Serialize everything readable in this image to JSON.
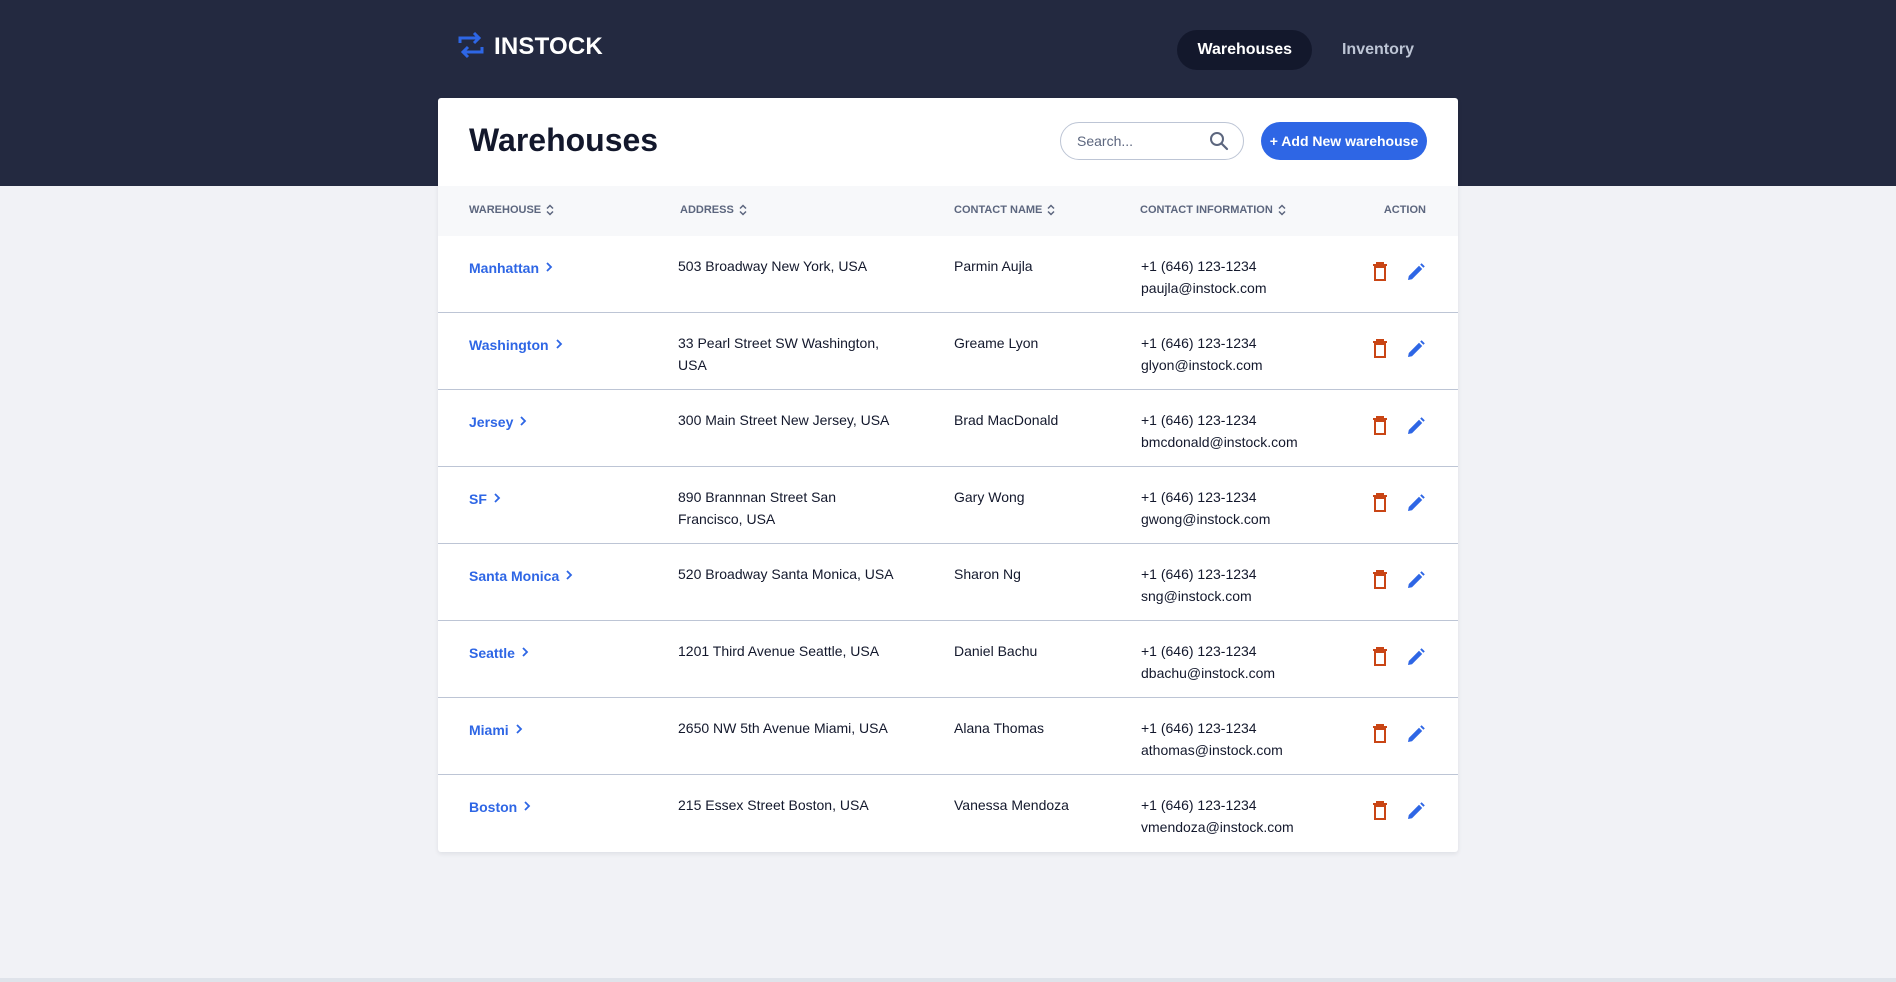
{
  "header": {
    "logo_text": "INSTOCK",
    "nav": [
      {
        "label": "Warehouses",
        "active": true
      },
      {
        "label": "Inventory",
        "active": false
      }
    ]
  },
  "page": {
    "title": "Warehouses",
    "search_placeholder": "Search...",
    "add_button_label": "+ Add New warehouse"
  },
  "table": {
    "columns": [
      "WAREHOUSE",
      "ADDRESS",
      "CONTACT NAME",
      "CONTACT INFORMATION",
      "ACTION"
    ],
    "rows": [
      {
        "warehouse": "Manhattan",
        "address": "503 Broadway New York, USA",
        "contact": "Parmin Aujla",
        "phone": "+1 (646) 123-1234",
        "email": "paujla@instock.com"
      },
      {
        "warehouse": "Washington",
        "address": "33 Pearl Street SW Washington, USA",
        "contact": "Greame Lyon",
        "phone": "+1 (646) 123-1234",
        "email": "glyon@instock.com"
      },
      {
        "warehouse": "Jersey",
        "address": "300 Main Street New Jersey, USA",
        "contact": "Brad MacDonald",
        "phone": "+1 (646) 123-1234",
        "email": "bmcdonald@instock.com"
      },
      {
        "warehouse": "SF",
        "address": "890 Brannnan Street San Francisco, USA",
        "contact": "Gary Wong",
        "phone": "+1 (646) 123-1234",
        "email": "gwong@instock.com"
      },
      {
        "warehouse": "Santa Monica",
        "address": "520 Broadway Santa Monica, USA",
        "contact": "Sharon Ng",
        "phone": "+1 (646) 123-1234",
        "email": "sng@instock.com"
      },
      {
        "warehouse": "Seattle",
        "address": "1201 Third Avenue Seattle, USA",
        "contact": "Daniel Bachu",
        "phone": "+1 (646) 123-1234",
        "email": "dbachu@instock.com"
      },
      {
        "warehouse": "Miami",
        "address": "2650 NW 5th Avenue Miami, USA",
        "contact": "Alana Thomas",
        "phone": "+1 (646) 123-1234",
        "email": "athomas@instock.com"
      },
      {
        "warehouse": "Boston",
        "address": "215 Essex Street Boston, USA",
        "contact": "Vanessa Mendoza",
        "phone": "+1 (646) 123-1234",
        "email": "vmendoza@instock.com"
      }
    ]
  },
  "icons": {
    "logo": "swap-arrows-icon",
    "search": "search-icon",
    "sort": "sort-icon",
    "chevron": "chevron-right-icon",
    "delete": "delete-icon",
    "edit": "edit-icon"
  },
  "colors": {
    "header_bg": "#232940",
    "accent": "#2e66e5",
    "delete": "#c94515",
    "page_bg": "#f1f2f6"
  }
}
